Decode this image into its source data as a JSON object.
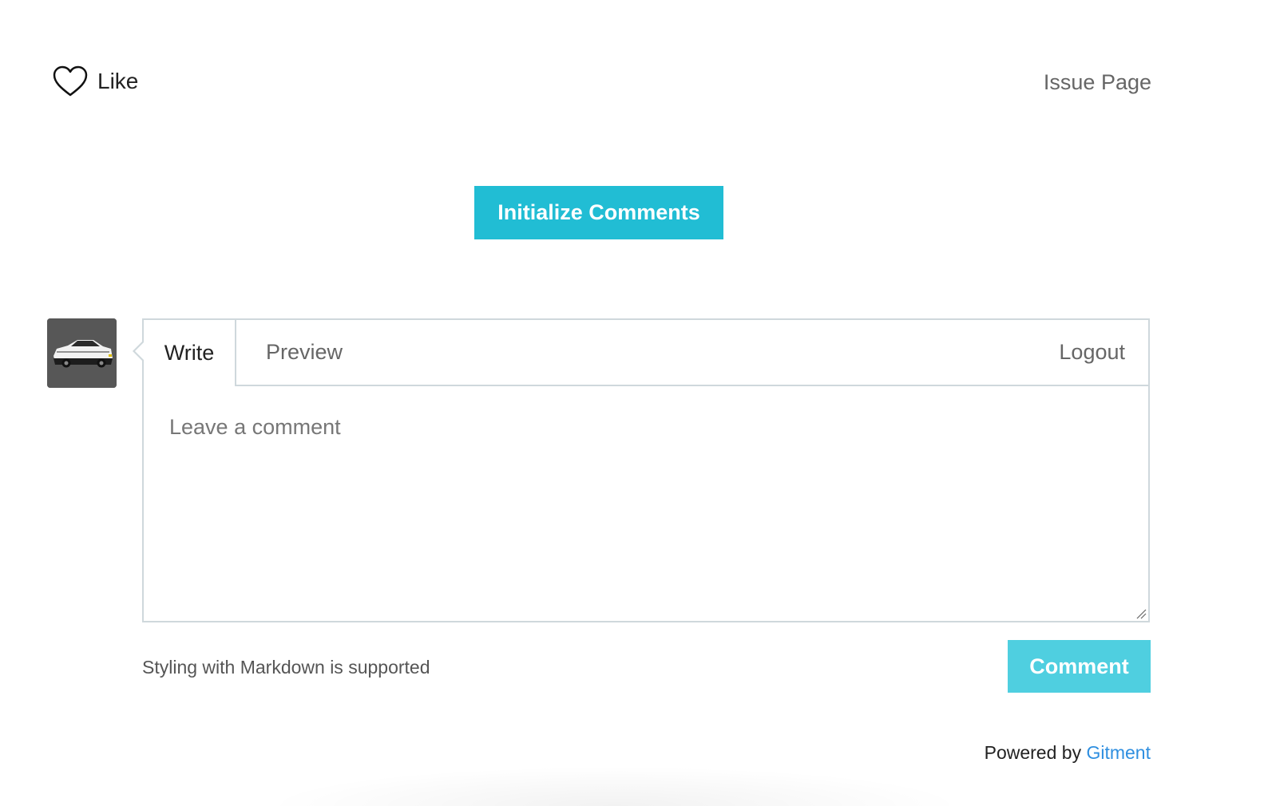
{
  "header": {
    "like_label": "Like",
    "issue_page_label": "Issue Page"
  },
  "init": {
    "button_label": "Initialize Comments"
  },
  "editor": {
    "tabs": {
      "write": "Write",
      "preview": "Preview",
      "logout": "Logout"
    },
    "placeholder": "Leave a comment",
    "value": ""
  },
  "footer": {
    "markdown_tip": "Styling with Markdown is supported",
    "comment_button": "Comment",
    "powered_prefix": "Powered by",
    "powered_link": "Gitment"
  },
  "icons": {
    "like": "heart-icon",
    "avatar": "car-avatar",
    "resize": "resize-grip-icon"
  },
  "colors": {
    "accent": "#21bdd4",
    "accent_light": "#4fcfe0",
    "link": "#2f8fe0",
    "border": "#cfd8dc"
  }
}
